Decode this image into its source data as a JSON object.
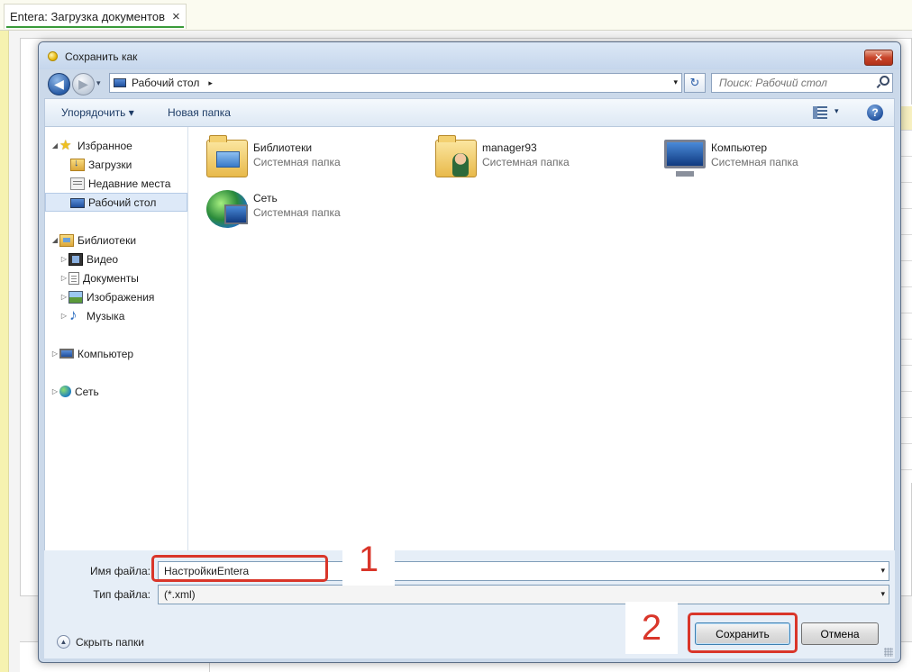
{
  "app": {
    "tab_title": "Entera: Загрузка документов",
    "tab_close": "×"
  },
  "dialog": {
    "title": "Сохранить как",
    "close": "✕",
    "nav": {
      "back": "◀",
      "forward": "▶",
      "recent": "▾",
      "address": "Рабочий стол",
      "address_arrow": "▸",
      "address_drop": "▾",
      "refresh": "↻",
      "search_placeholder": "Поиск: Рабочий стол"
    },
    "toolbar": {
      "organize": "Упорядочить ▾",
      "new_folder": "Новая папка",
      "view_drop": "▾",
      "help": "?"
    },
    "tree": {
      "favorites": "Избранное",
      "downloads": "Загрузки",
      "recent_places": "Недавние места",
      "desktop": "Рабочий стол",
      "libraries": "Библиотеки",
      "video": "Видео",
      "documents": "Документы",
      "images": "Изображения",
      "music": "Музыка",
      "computer": "Компьютер",
      "network": "Сеть",
      "tri_open": "◢",
      "tri_closed": "▷"
    },
    "files": [
      {
        "name": "Библиотеки",
        "type": "Системная папка"
      },
      {
        "name": "manager93",
        "type": "Системная папка"
      },
      {
        "name": "Компьютер",
        "type": "Системная папка"
      },
      {
        "name": "Сеть",
        "type": "Системная папка"
      }
    ],
    "form": {
      "filename_label": "Имя файла:",
      "filename_value": "НастройкиEntera",
      "filetype_label": "Тип файла:",
      "filetype_value": "(*.xml)",
      "drop": "▾",
      "hide_folders": "Скрыть папки",
      "hide_icon": "▲",
      "save": "Сохранить",
      "cancel": "Отмена"
    }
  },
  "annotations": {
    "step1": "1",
    "step2": "2",
    "color": "#d9362a"
  }
}
